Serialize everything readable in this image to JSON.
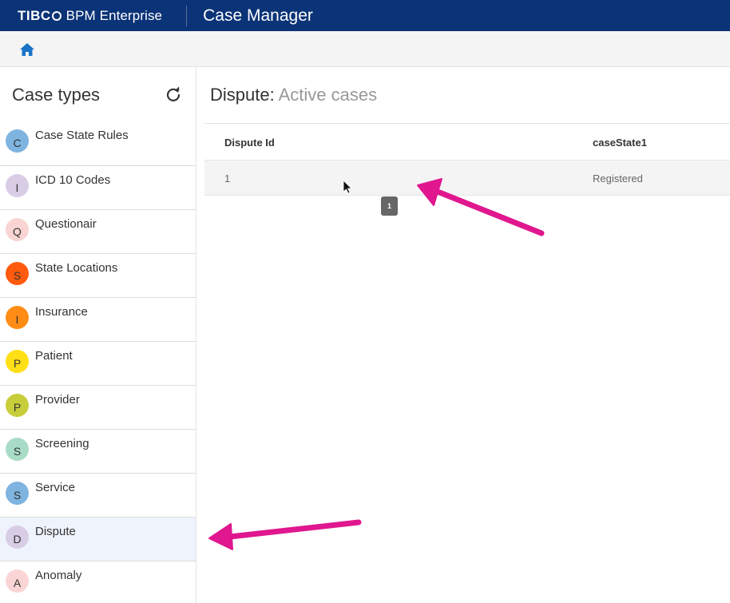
{
  "header": {
    "brand_logo": "TIBC",
    "brand_product": "BPM Enterprise",
    "app_title": "Case Manager",
    "bg_color": "#0b3377"
  },
  "subbar": {
    "home_icon": "home-icon",
    "home_color": "#1a73c8"
  },
  "sidebar": {
    "title": "Case types",
    "refresh_icon": "refresh-icon",
    "items": [
      {
        "letter": "C",
        "label": "Case State Rules",
        "color": "#7fb3e0"
      },
      {
        "letter": "I",
        "label": "ICD 10 Codes",
        "color": "#d9cde6"
      },
      {
        "letter": "Q",
        "label": "Questionair",
        "color": "#f8d5d3"
      },
      {
        "letter": "S",
        "label": "State Locations",
        "color": "#ff5a0e"
      },
      {
        "letter": "I",
        "label": "Insurance",
        "color": "#ff8c14"
      },
      {
        "letter": "P",
        "label": "Patient",
        "color": "#ffdf16"
      },
      {
        "letter": "P",
        "label": "Provider",
        "color": "#c8cd3a"
      },
      {
        "letter": "S",
        "label": "Screening",
        "color": "#a9dcc7"
      },
      {
        "letter": "S",
        "label": "Service",
        "color": "#7fb3e0"
      },
      {
        "letter": "D",
        "label": "Dispute",
        "color": "#d9cde6",
        "selected": true
      },
      {
        "letter": "A",
        "label": "Anomaly",
        "color": "#fbd5d6"
      }
    ]
  },
  "main": {
    "title_type": "Dispute:",
    "title_view": "Active cases",
    "columns": [
      "Dispute Id",
      "caseState1"
    ],
    "rows": [
      [
        "1",
        "Registered"
      ]
    ],
    "pager_page": "1"
  },
  "annotations": {
    "arrow_color": "#e0178f"
  }
}
